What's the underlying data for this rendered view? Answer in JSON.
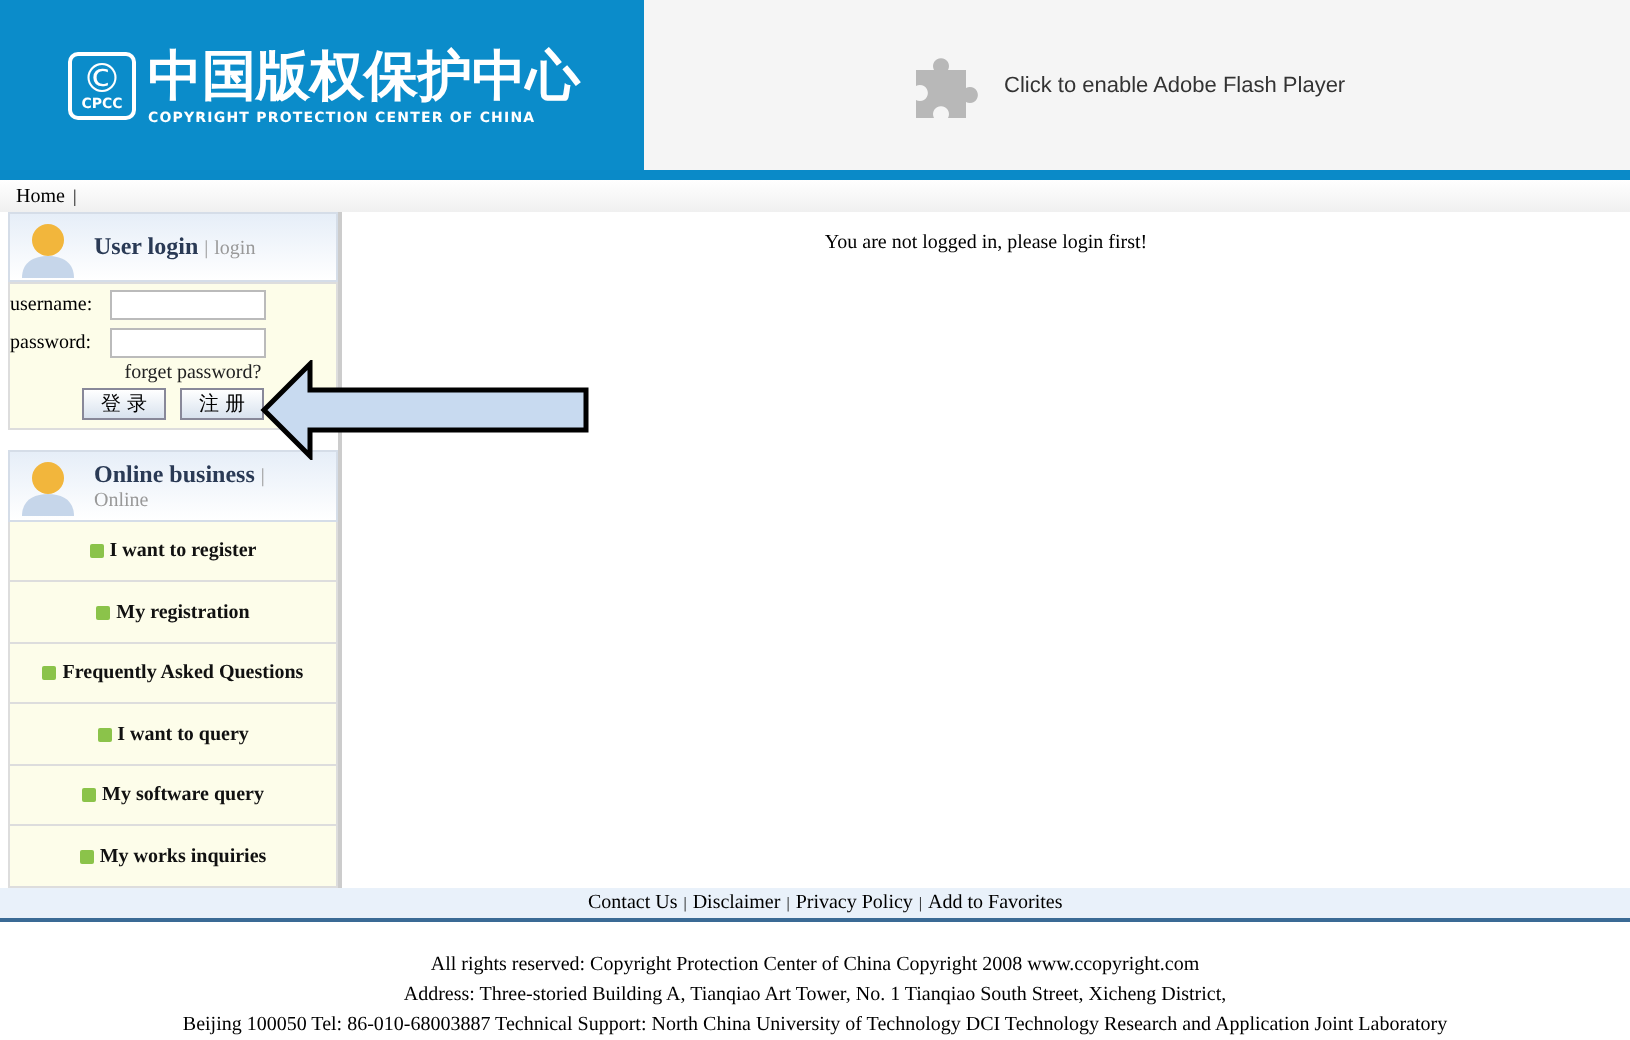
{
  "header": {
    "logo_mark": "©",
    "logo_abbr": "CPCC",
    "logo_title": "中国版权保护中心",
    "logo_subtitle": "COPYRIGHT PROTECTION CENTER OF CHINA",
    "flash_prompt": "Click to enable Adobe Flash Player"
  },
  "nav": [
    {
      "label": "Home",
      "separator": "|"
    }
  ],
  "login": {
    "title": "User login",
    "separator": "|",
    "subtitle": "login",
    "username_label": "username:",
    "password_label": "password:",
    "forgot": "forget password?",
    "buttons": [
      "登 录",
      "注 册"
    ]
  },
  "business": {
    "title": "Online business",
    "separator": "|",
    "subtitle": "Online",
    "items": [
      {
        "label": "I want to register"
      },
      {
        "label": "My registration"
      },
      {
        "label": "Frequently Asked Questions"
      },
      {
        "label": "I want to query"
      },
      {
        "label": "My software query"
      },
      {
        "label": "My works inquiries"
      }
    ]
  },
  "main": {
    "message": "You are not logged in, please login first!"
  },
  "footer_links": [
    {
      "label": "Contact Us",
      "separator": "|"
    },
    {
      "label": "Disclaimer",
      "separator": "|"
    },
    {
      "label": "Privacy Policy",
      "separator": "|"
    },
    {
      "label": "Add to Favorites"
    }
  ],
  "footer_lines": [
    "All rights reserved: Copyright Protection Center of China Copyright 2008 www.ccopyright.com",
    "Address: Three-storied Building A, Tianqiao Art Tower, No. 1 Tianqiao South Street, Xicheng District,",
    "Beijing 100050 Tel: 86-010-68003887 Technical Support: North China University of Technology DCI Technology Research and Application Joint Laboratory"
  ]
}
